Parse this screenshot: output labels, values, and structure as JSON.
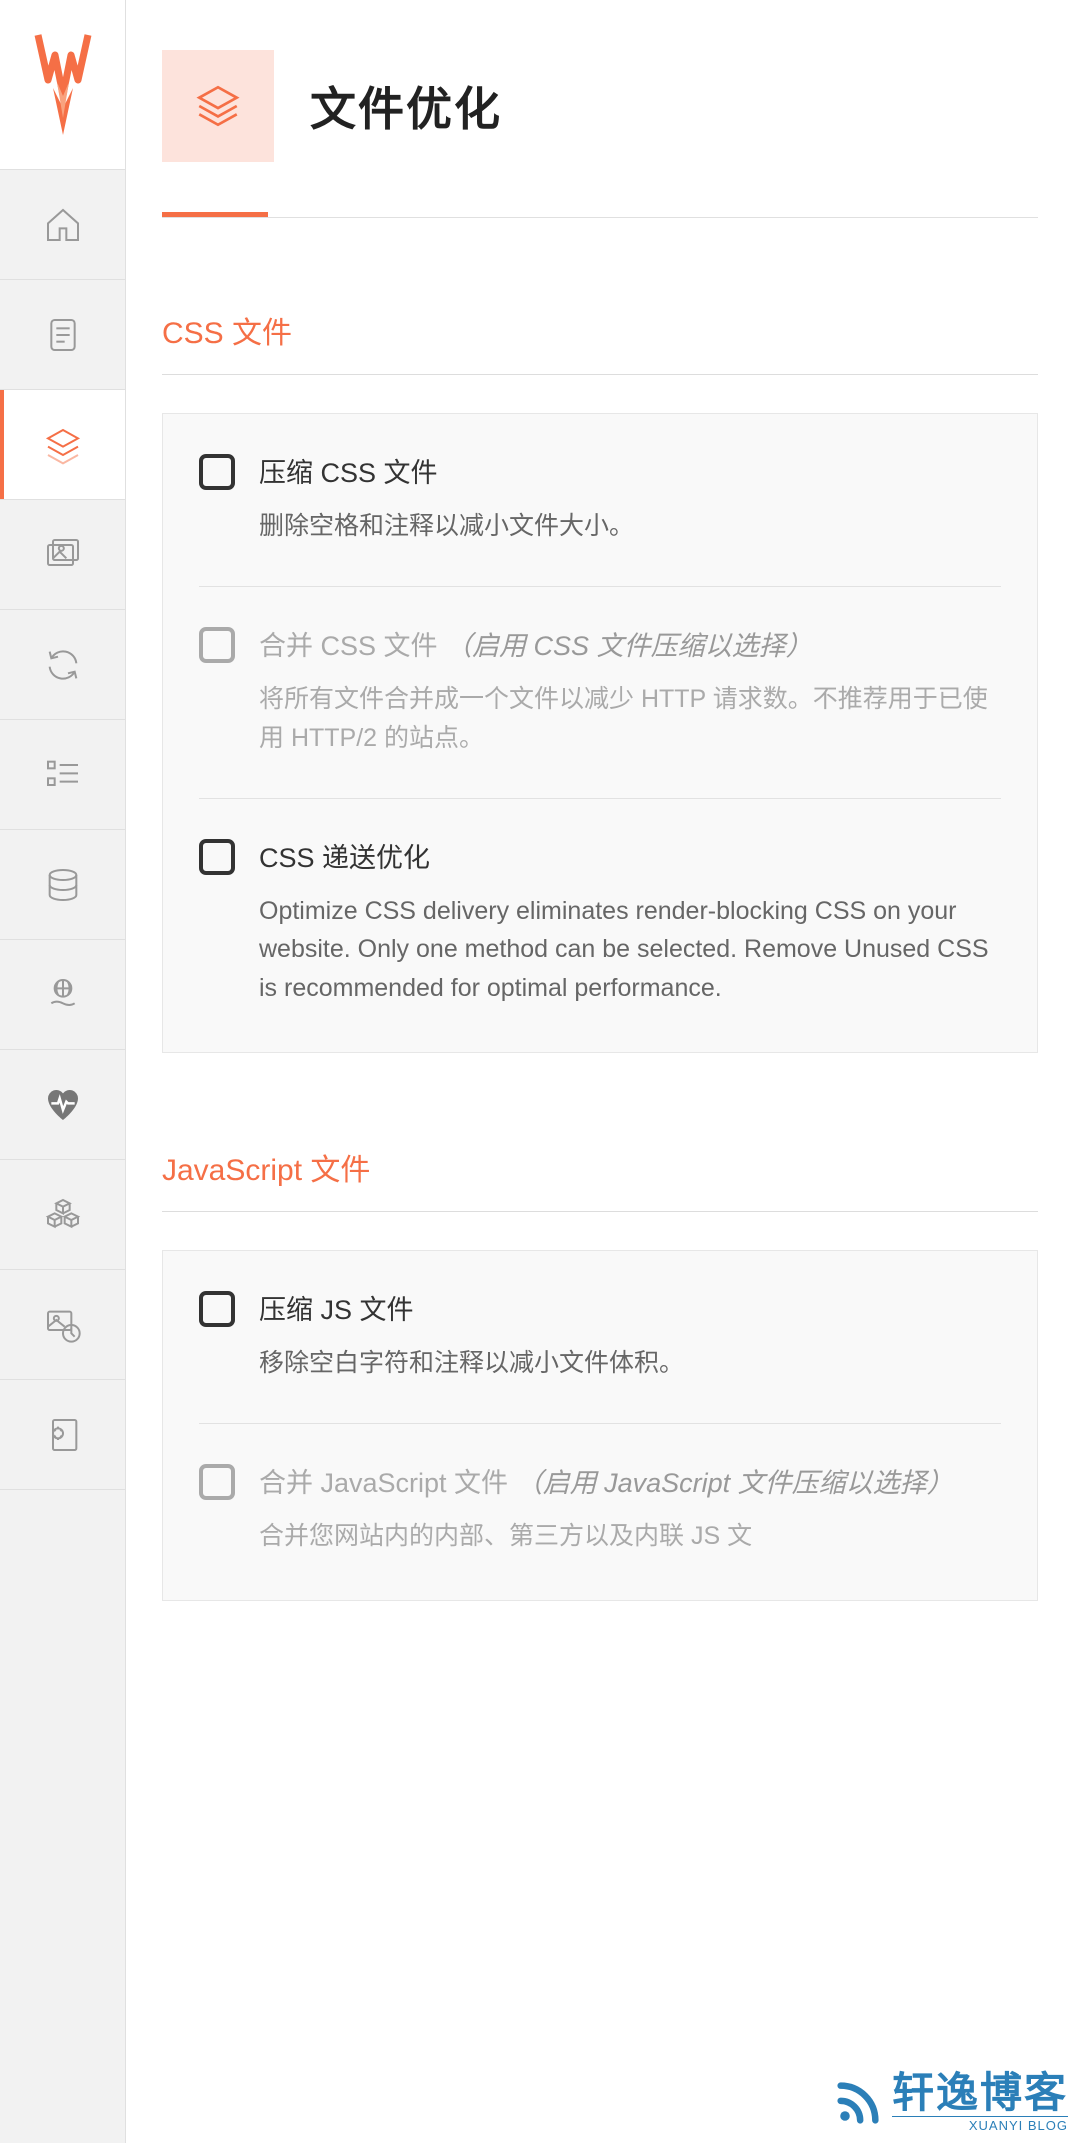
{
  "header": {
    "title": "文件优化"
  },
  "sections": {
    "css": {
      "title": "CSS 文件",
      "options": [
        {
          "label": "压缩 CSS 文件",
          "desc": "删除空格和注释以减小文件大小。"
        },
        {
          "label": "合并 CSS 文件",
          "hint": "（启用 CSS 文件压缩以选择）",
          "desc": "将所有文件合并成一个文件以减少 HTTP 请求数。不推荐用于已使用 HTTP/2 的站点。"
        },
        {
          "label": "CSS 递送优化",
          "desc": "Optimize CSS delivery eliminates render-blocking CSS on your website. Only one method can be selected. Remove Unused CSS is recommended for optimal performance."
        }
      ]
    },
    "js": {
      "title": "JavaScript 文件",
      "options": [
        {
          "label": "压缩 JS 文件",
          "desc": "移除空白字符和注释以减小文件体积。"
        },
        {
          "label": "合并 JavaScript 文件",
          "hint": "（启用 JavaScript 文件压缩以选择）",
          "desc": "合并您网站内的内部、第三方以及内联 JS 文"
        }
      ]
    }
  },
  "watermark": {
    "cn": "轩逸博客",
    "en": "XUANYI BLOG"
  }
}
